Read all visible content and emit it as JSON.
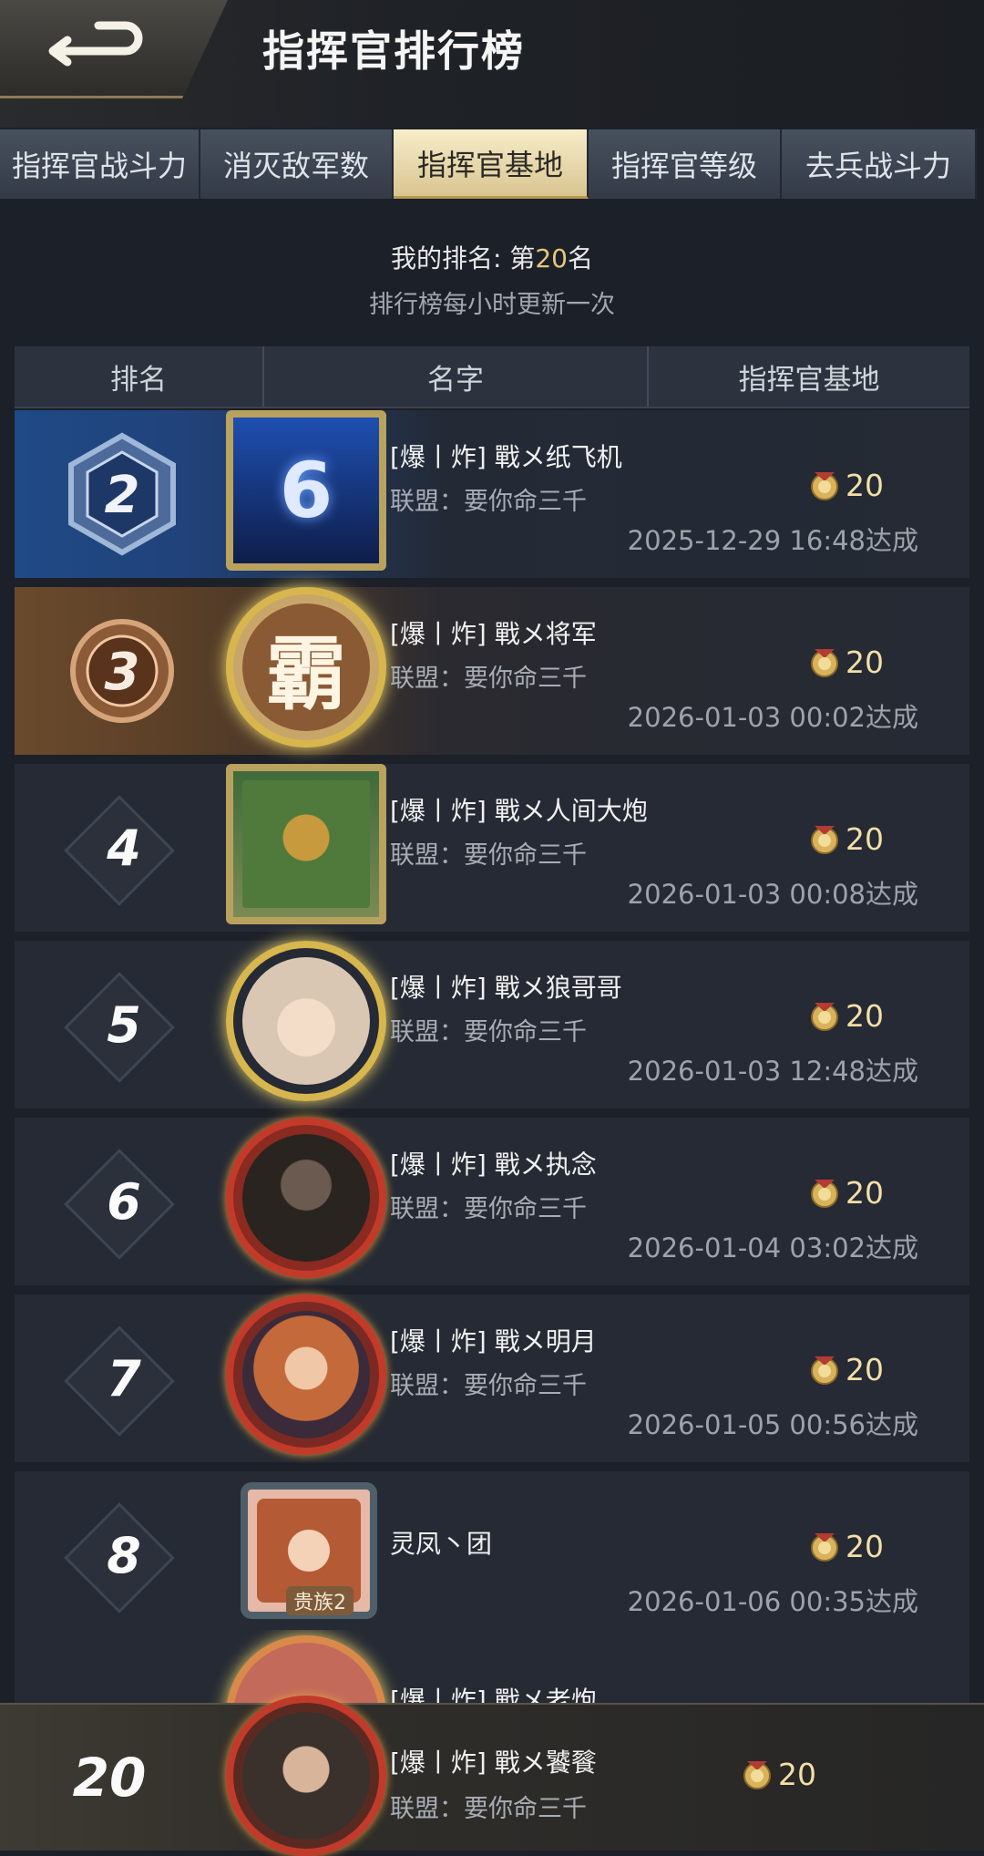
{
  "header": {
    "title": "指挥官排行榜"
  },
  "tabs": [
    {
      "label": "指挥官战斗力",
      "active": false
    },
    {
      "label": "消灭敌军数",
      "active": false
    },
    {
      "label": "指挥官基地",
      "active": true
    },
    {
      "label": "指挥官等级",
      "active": false
    },
    {
      "label": "去兵战斗力",
      "active": false
    }
  ],
  "my_rank": {
    "prefix": "我的排名: 第",
    "number": "20",
    "suffix": "名",
    "update_note": "排行榜每小时更新一次"
  },
  "table_header": {
    "rank": "排名",
    "name": "名字",
    "base": "指挥官基地"
  },
  "rows": [
    {
      "rank": "2",
      "name": "[爆丨炸] 戰メ纸飞机",
      "alliance": "联盟：要你命三千",
      "score": "20",
      "date": "2025-12-29 16:48达成",
      "avatar_glyph": "6"
    },
    {
      "rank": "3",
      "name": "[爆丨炸] 戰メ将军",
      "alliance": "联盟：要你命三千",
      "score": "20",
      "date": "2026-01-03 00:02达成",
      "avatar_glyph": "霸"
    },
    {
      "rank": "4",
      "name": "[爆丨炸] 戰メ人间大炮",
      "alliance": "联盟：要你命三千",
      "score": "20",
      "date": "2026-01-03 00:08达成",
      "avatar_glyph": ""
    },
    {
      "rank": "5",
      "name": "[爆丨炸] 戰メ狼哥哥",
      "alliance": "联盟：要你命三千",
      "score": "20",
      "date": "2026-01-03 12:48达成",
      "avatar_glyph": ""
    },
    {
      "rank": "6",
      "name": "[爆丨炸] 戰メ执念",
      "alliance": "联盟：要你命三千",
      "score": "20",
      "date": "2026-01-04 03:02达成",
      "avatar_glyph": ""
    },
    {
      "rank": "7",
      "name": "[爆丨炸] 戰メ明月",
      "alliance": "联盟：要你命三千",
      "score": "20",
      "date": "2026-01-05 00:56达成",
      "avatar_glyph": ""
    },
    {
      "rank": "8",
      "name": "灵凤丶团",
      "alliance": "",
      "score": "20",
      "date": "2026-01-06 00:35达成",
      "avatar_glyph": "",
      "avatar_tag": "贵族2"
    }
  ],
  "partial_row": {
    "name": "[爆丨炸] 戰メ老炮"
  },
  "my_row": {
    "rank": "20",
    "name": "[爆丨炸] 戰メ饕餮",
    "alliance": "联盟：要你命三千",
    "score": "20"
  },
  "colors": {
    "gold": "#e7c77a",
    "tab_active": "#f7edc9",
    "row_bg": "#252a34"
  }
}
